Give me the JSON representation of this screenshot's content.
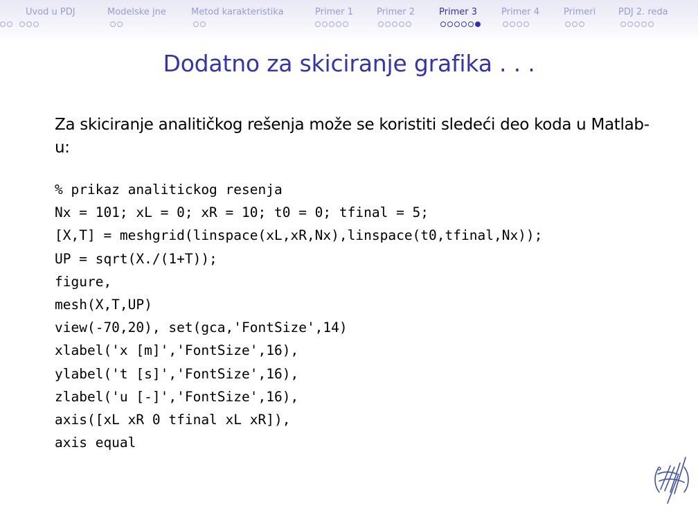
{
  "nav": {
    "sections": [
      {
        "label": "Uvod u PDJ",
        "dots": 5,
        "filled": -1,
        "active": false
      },
      {
        "label": "Modelske jne",
        "dots": 2,
        "filled": -1,
        "active": false
      },
      {
        "label": "Metod karakteristika",
        "dots": 2,
        "filled": -1,
        "active": false
      },
      {
        "label": "Primer 1",
        "dots": 5,
        "filled": -1,
        "active": false
      },
      {
        "label": "Primer 2",
        "dots": 5,
        "filled": -1,
        "active": false
      },
      {
        "label": "Primer 3",
        "dots": 6,
        "filled": 5,
        "active": true
      },
      {
        "label": "Primer 4",
        "dots": 4,
        "filled": -1,
        "active": false
      },
      {
        "label": "Primeri",
        "dots": 3,
        "filled": -1,
        "active": false
      },
      {
        "label": "PDJ 2. reda",
        "dots": 5,
        "filled": -1,
        "active": false
      }
    ]
  },
  "slide": {
    "title": "Dodatno za skiciranje grafika . . .",
    "intro": "Za skiciranje analitičkog rešenja može se koristiti sledeći deo koda u Matlab-u:",
    "code_lines": [
      "% prikaz analitickog resenja",
      "Nx = 101; xL = 0; xR = 10; t0 = 0; tfinal = 5;",
      "[X,T] = meshgrid(linspace(xL,xR,Nx),linspace(t0,tfinal,Nx));",
      "UP = sqrt(X./(1+T));",
      "figure,",
      "mesh(X,T,UP)",
      "view(-70,20), set(gca,'FontSize',14)",
      "xlabel('x [m]','FontSize',16),",
      "ylabel('t [s]','FontSize',16),",
      "zlabel('u [-]','FontSize',16),",
      "axis([xL xR 0 tfinal xL xR]),",
      "axis equal"
    ]
  },
  "colors": {
    "accent": "#3333b3",
    "nav_inactive": "#9a9ad6"
  },
  "icons": {
    "logo": "university-logo"
  }
}
